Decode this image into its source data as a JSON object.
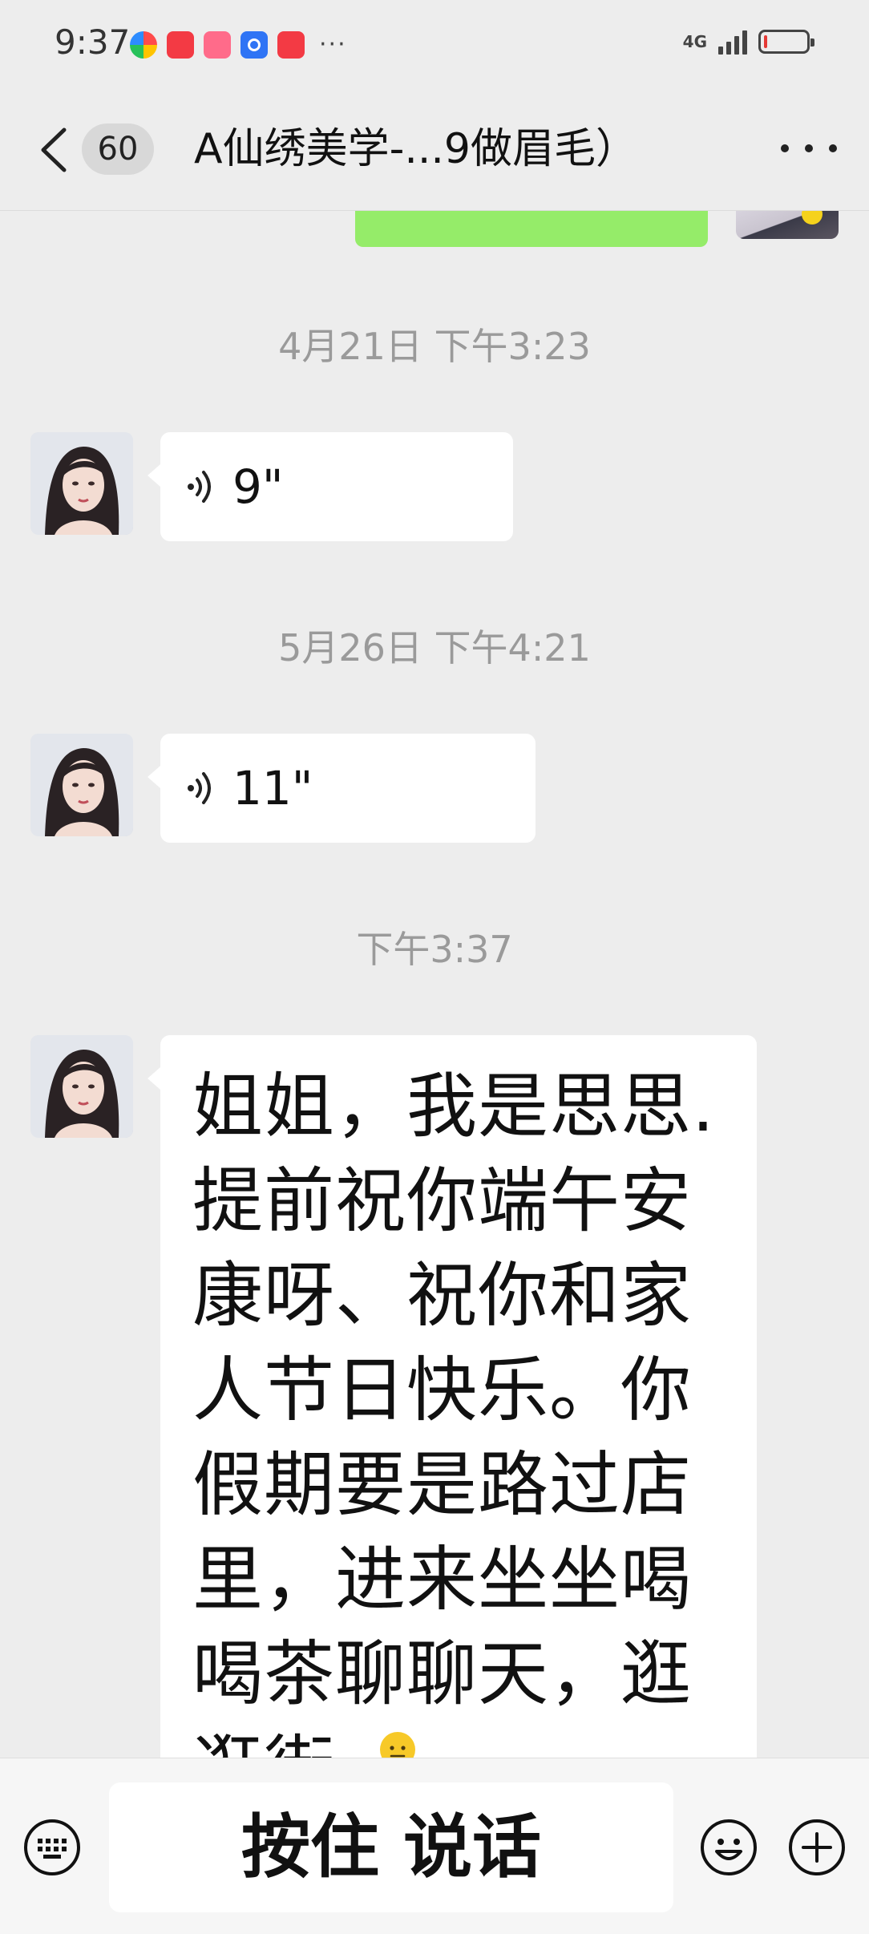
{
  "status_bar": {
    "time": "9:37",
    "more": "···",
    "network": "4G",
    "battery_level_fraction": 0.08
  },
  "nav": {
    "unread_count": "60",
    "title": "A仙绣美学-...9做眉毛）"
  },
  "messages": [
    {
      "timestamp": "4月21日 下午3:23",
      "type": "voice",
      "duration": "9\""
    },
    {
      "timestamp": "5月26日 下午4:21",
      "type": "voice",
      "duration": "11\""
    },
    {
      "timestamp": "下午3:37",
      "type": "text",
      "text": "姐姐，我是思思.提前祝你端午安康呀、祝你和家人节日快乐。你假期要是路过店里，进来坐坐喝喝茶聊聊天，逛逛街.",
      "emoji": "person-shrugging-emoji"
    }
  ],
  "input_bar": {
    "hold_to_talk_label": "按住 说话"
  },
  "icons": {
    "back": "chevron-left-icon",
    "more": "more-dots-icon",
    "voice": "voice-wave-icon",
    "keyboard": "keyboard-icon",
    "emoji": "smiley-icon",
    "plus": "plus-circle-icon"
  },
  "colors": {
    "background": "#ededed",
    "own_bubble": "#95ec69",
    "other_bubble": "#ffffff",
    "timestamp": "#9a9a9a",
    "battery_low": "#e53935"
  }
}
